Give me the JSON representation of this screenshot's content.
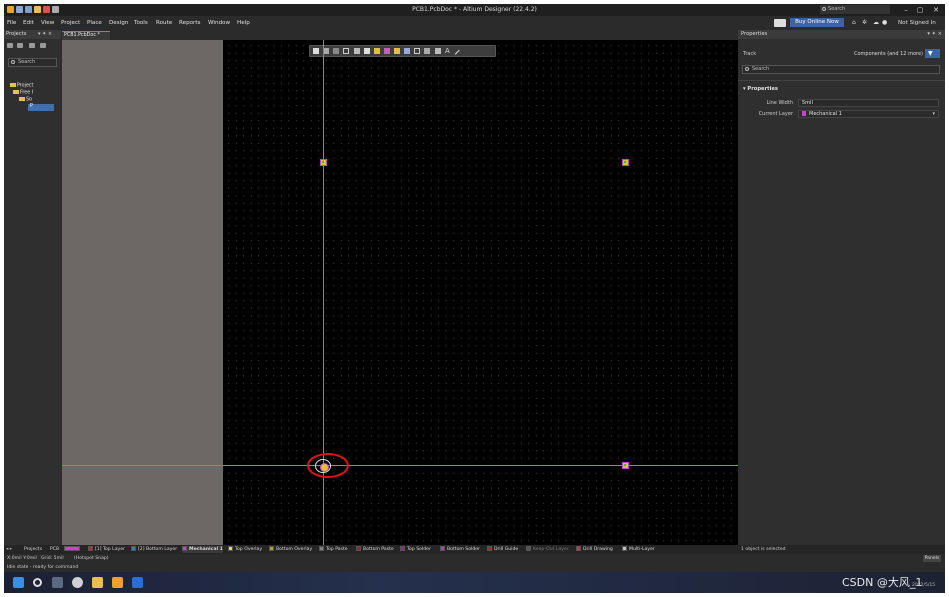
{
  "app": {
    "title": "PCB1.PcbDoc * - Altium Designer (22.4.2)",
    "search_placeholder": "Search"
  },
  "menu": [
    "File",
    "Edit",
    "View",
    "Project",
    "Place",
    "Design",
    "Tools",
    "Route",
    "Reports",
    "Window",
    "Help"
  ],
  "menu_right": {
    "buy_label": "Buy Online Now",
    "user_label": "Not Signed In"
  },
  "projects_panel": {
    "title": "Projects",
    "search_placeholder": "Search",
    "tree": {
      "project": "Project",
      "free": "Free I",
      "source": "So",
      "file": "P"
    }
  },
  "document_tab": "PCB1.PcbDoc *",
  "properties_panel": {
    "title": "Properties",
    "object_type": "Track",
    "filter_label": "Components (and 12 more)",
    "search_placeholder": "Search",
    "section": "Properties",
    "line_width_label": "Line Width",
    "line_width_value": "5mil",
    "current_layer_label": "Current Layer",
    "current_layer_value": "Mechanical 1",
    "current_layer_color": "#d040d0"
  },
  "layer_bar": {
    "nav_tabs": [
      "Projects",
      "PCB"
    ],
    "layers": [
      {
        "label": "[1] Top Layer",
        "color": "#e02020"
      },
      {
        "label": "[2] Bottom Layer",
        "color": "#2080e0"
      },
      {
        "label": "Mechanical 1",
        "color": "#d040d0",
        "active": true
      },
      {
        "label": "Top Overlay",
        "color": "#f0e020"
      },
      {
        "label": "Bottom Overlay",
        "color": "#a0a040"
      },
      {
        "label": "Top Paste",
        "color": "#808080"
      },
      {
        "label": "Bottom Paste",
        "color": "#a02020"
      },
      {
        "label": "Top Solder",
        "color": "#a020a0"
      },
      {
        "label": "Bottom Solder",
        "color": "#b040b0"
      },
      {
        "label": "Drill Guide",
        "color": "#c02020"
      },
      {
        "label": "Keep-Out Layer",
        "color": "#d040d0"
      },
      {
        "label": "Drill Drawing",
        "color": "#e03030"
      },
      {
        "label": "Multi-Layer",
        "color": "#c0c0c0"
      }
    ],
    "selection_status": "1 object is selected"
  },
  "status": {
    "coords": "X:0mil Y:0mil",
    "grid": "Grid: 5mil",
    "snap": "(Hotspot Snap)",
    "panels_button": "Panels",
    "state": "Idle state - ready for command"
  },
  "watermark": "CSDN @大风_1",
  "tray_date": "2022/5/15",
  "icons": [
    "search-icon",
    "home-icon",
    "gear-icon",
    "user-icon",
    "filter-icon",
    "windows-start-icon",
    "folder-icon"
  ]
}
